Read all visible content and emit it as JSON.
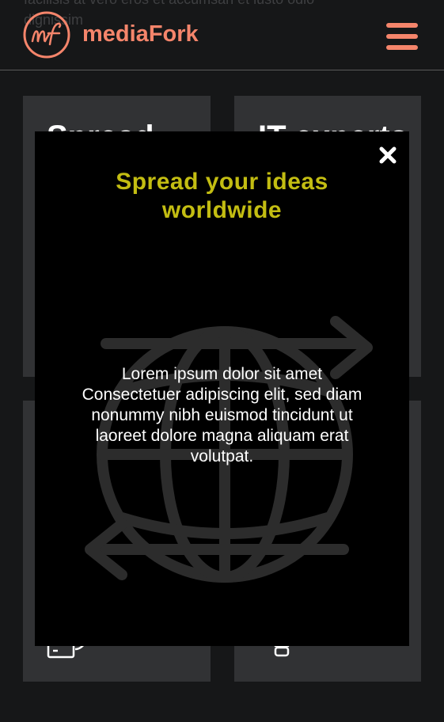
{
  "header": {
    "background_text": [
      "facilisis at vero eros et accumsan et iusto odio",
      "dignissim"
    ],
    "brand": "mediaFork",
    "brand_color": "#f5856b",
    "menu_icon": "hamburger-menu-icon"
  },
  "cards": [
    {
      "title": "Spread",
      "icon": "desktop-person-icon"
    },
    {
      "title": "IT experts",
      "icon": "lightbulb-icon"
    },
    {
      "title": "",
      "icon": "camera-icon"
    },
    {
      "title": "",
      "icon": "bulb-base-icon"
    }
  ],
  "modal": {
    "close_icon": "close-icon",
    "title": "Spread your ideas worldwide",
    "title_color": "#c3bd12",
    "body_lines": [
      "Lorem ipsum dolor sit amet",
      "Consectetuer adipiscing elit, sed diam",
      "nonummy nibh euismod tincidunt ut",
      "laoreet dolore magna aliquam erat",
      "volutpat."
    ],
    "background_icon": "globe-arrows-icon"
  }
}
